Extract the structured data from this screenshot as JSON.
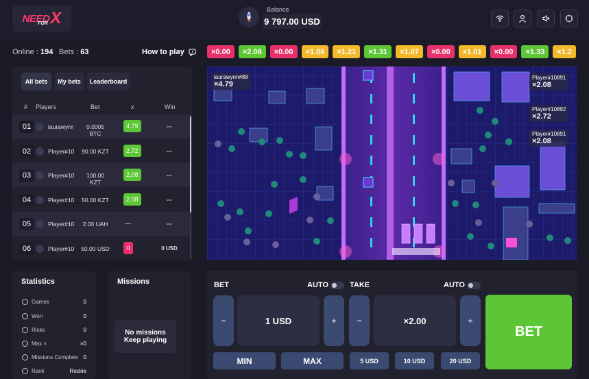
{
  "header": {
    "logo_text": {
      "need": "NEED",
      "for": "FOR",
      "x": "X"
    },
    "balance_label": "Balance",
    "balance_value": "9 797.00 USD",
    "icons": [
      "wifi-icon",
      "user-icon",
      "sound-off-icon",
      "chip-icon"
    ]
  },
  "info": {
    "online_label": "Online :",
    "online_value": "194",
    "bets_label": "Bets :",
    "bets_value": "63",
    "how_to_play": "How to play"
  },
  "multipliers": [
    {
      "label": "×0.00",
      "color": "#e8316b"
    },
    {
      "label": "×2.08",
      "color": "#5cc637"
    },
    {
      "label": "×0.00",
      "color": "#e8316b"
    },
    {
      "label": "×1.06",
      "color": "#f2b82a"
    },
    {
      "label": "×1.21",
      "color": "#f2b82a"
    },
    {
      "label": "×1.31",
      "color": "#5cc637"
    },
    {
      "label": "×1.07",
      "color": "#f2b82a"
    },
    {
      "label": "×0.00",
      "color": "#e8316b"
    },
    {
      "label": "×1.01",
      "color": "#f2b82a"
    },
    {
      "label": "×0.00",
      "color": "#e8316b"
    },
    {
      "label": "×1.33",
      "color": "#5cc637"
    },
    {
      "label": "×1.2",
      "color": "#f2b82a"
    }
  ],
  "tabs": {
    "all_bets": "All bets",
    "my_bets": "My bets",
    "leaderboard": "Leaderboard"
  },
  "table": {
    "headers": {
      "num": "#",
      "players": "Players",
      "bet": "Bet",
      "x": "x",
      "win": "Win"
    },
    "rows": [
      {
        "num": "01",
        "player": "laurawynr",
        "bet": "0.0005 BTC",
        "x": "4.79",
        "x_color": "#5cc637",
        "win": "---"
      },
      {
        "num": "02",
        "player": "Player#10",
        "bet": "90.00 KZT",
        "x": "2.72",
        "x_color": "#5cc637",
        "win": "---"
      },
      {
        "num": "03",
        "player": "Player#10",
        "bet": "100.00 KZT",
        "x": "2.08",
        "x_color": "#5cc637",
        "win": "---"
      },
      {
        "num": "04",
        "player": "Player#10",
        "bet": "50.00 KZT",
        "x": "2.08",
        "x_color": "#5cc637",
        "win": "---"
      },
      {
        "num": "05",
        "player": "Player#10",
        "bet": "2.00 UAH",
        "x": "---",
        "x_color": "",
        "win": "---"
      },
      {
        "num": "06",
        "player": "Player#10",
        "bet": "50.00 USD",
        "x": "0",
        "x_color": "#e8316b",
        "win": "0 USD"
      }
    ]
  },
  "statistics": {
    "title": "Statistics",
    "rows": [
      {
        "label": "Games",
        "value": "0"
      },
      {
        "label": "Won",
        "value": "0"
      },
      {
        "label": "Risks",
        "value": "0"
      },
      {
        "label": "Max ×",
        "value": "×0"
      },
      {
        "label": "Missions Complete",
        "value": "0"
      },
      {
        "label": "Rank",
        "value": "Rockie"
      }
    ]
  },
  "missions": {
    "title": "Missions",
    "empty_line1": "No missions",
    "empty_line2": "Keep playing"
  },
  "game_overlays": [
    {
      "player": "laurawynn#88",
      "mult": "×4.79"
    },
    {
      "player": "Player#10891",
      "mult": "×2.08"
    },
    {
      "player": "Player#10892",
      "mult": "×2.72"
    },
    {
      "player": "Player#10891",
      "mult": "×2.08"
    }
  ],
  "controls": {
    "bet_label": "BET",
    "auto_label": "AUTO",
    "take_label": "TAKE",
    "auto2_label": "AUTO",
    "minus": "−",
    "plus": "+",
    "bet_value": "1 USD",
    "take_value": "×2.00",
    "min": "MIN",
    "max": "MAX",
    "q1": "5 USD",
    "q2": "10 USD",
    "q3": "20 USD",
    "bet_button": "BET"
  }
}
